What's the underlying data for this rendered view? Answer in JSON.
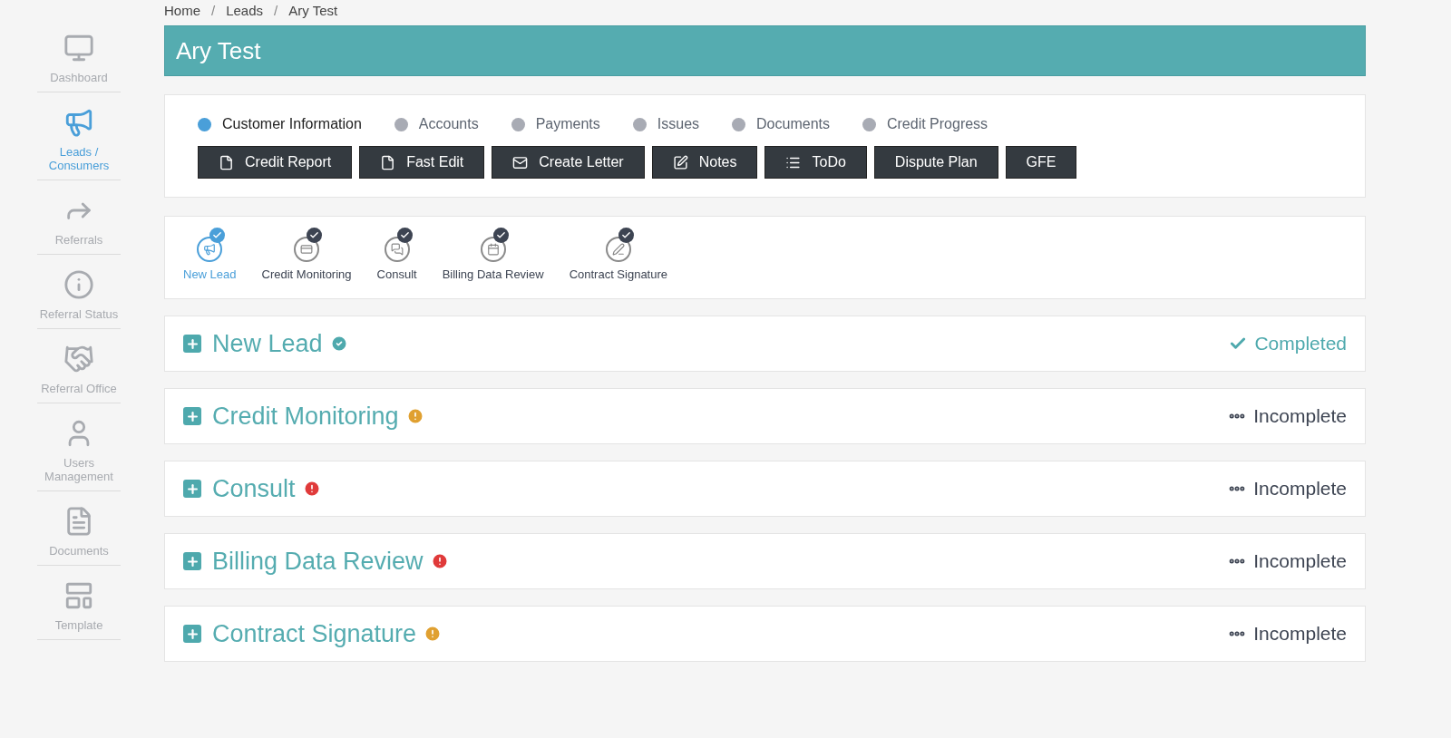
{
  "sidebar": {
    "items": [
      {
        "label": "Dashboard",
        "selected": false
      },
      {
        "label": "Leads / Consumers",
        "selected": true
      },
      {
        "label": "Referrals",
        "selected": false
      },
      {
        "label": "Referral Status",
        "selected": false
      },
      {
        "label": "Referral Office",
        "selected": false
      },
      {
        "label": "Users Management",
        "selected": false
      },
      {
        "label": "Documents",
        "selected": false
      },
      {
        "label": "Template",
        "selected": false
      }
    ]
  },
  "breadcrumb": [
    {
      "kind": "link",
      "text": "Home"
    },
    {
      "kind": "separator",
      "text": "/"
    },
    {
      "kind": "link",
      "text": "Leads"
    },
    {
      "kind": "separator",
      "text": "/"
    },
    {
      "kind": "link",
      "text": "Ary Test"
    }
  ],
  "title": "Ary Test",
  "tabs": [
    {
      "label": "Customer Information",
      "selected": true
    },
    {
      "label": "Accounts",
      "selected": false
    },
    {
      "label": "Payments",
      "selected": false
    },
    {
      "label": "Issues",
      "selected": false
    },
    {
      "label": "Documents",
      "selected": false
    },
    {
      "label": "Credit Progress",
      "selected": false
    }
  ],
  "buttons": [
    "Credit Report",
    "Fast Edit",
    "Create Letter",
    "Notes",
    "ToDo",
    "Dispute Plan",
    "GFE"
  ],
  "steps": [
    {
      "label": "New Lead",
      "selected": true
    },
    {
      "label": "Credit Monitoring",
      "selected": false
    },
    {
      "label": "Consult",
      "selected": false
    },
    {
      "label": "Billing Data Review",
      "selected": false
    },
    {
      "label": "Contract Signature",
      "selected": false
    }
  ],
  "sections": [
    {
      "title": "New Lead",
      "color": "#4ea9ad",
      "status": "Completed",
      "kind": "completed"
    },
    {
      "title": "Credit Monitoring",
      "color": "#e0a030",
      "status": "Incomplete",
      "kind": "incomplete"
    },
    {
      "title": "Consult",
      "color": "#e03a3a",
      "status": "Incomplete",
      "kind": "incomplete"
    },
    {
      "title": "Billing Data Review",
      "color": "#e03a3a",
      "status": "Incomplete",
      "kind": "incomplete"
    },
    {
      "title": "Contract Signature",
      "color": "#e0a030",
      "status": "Incomplete",
      "kind": "incomplete"
    }
  ]
}
